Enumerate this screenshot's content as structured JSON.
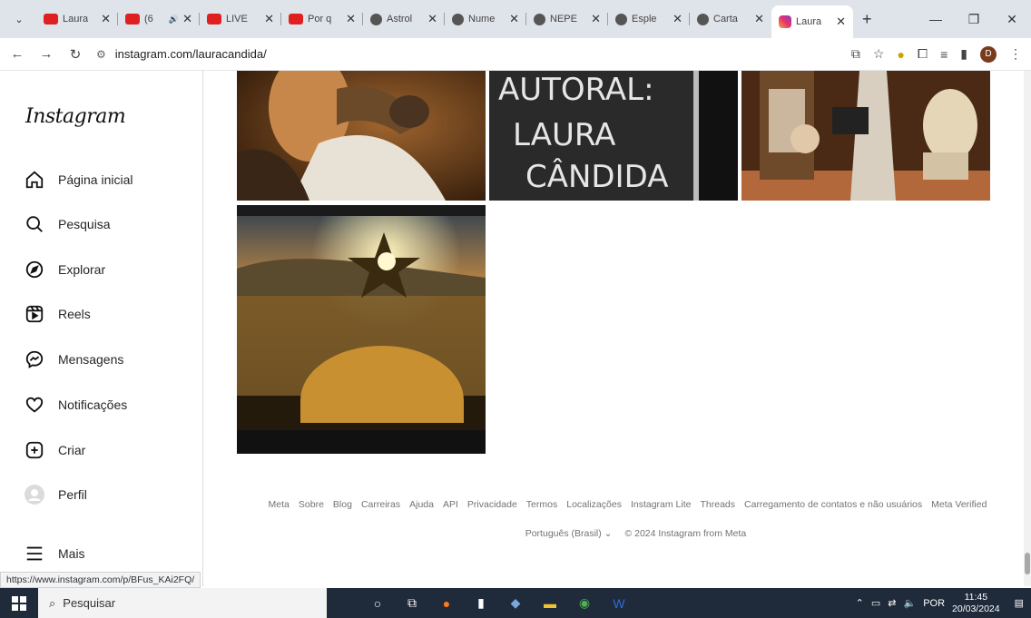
{
  "browser": {
    "tabs": [
      {
        "label": "Laura",
        "icon": "youtube-icon",
        "type": "yt"
      },
      {
        "label": "(6",
        "icon": "youtube-icon",
        "type": "yt",
        "audio": "🔊"
      },
      {
        "label": "LIVE",
        "icon": "youtube-icon",
        "type": "yt"
      },
      {
        "label": "Por q",
        "icon": "youtube-icon",
        "type": "yt"
      },
      {
        "label": "Astrol",
        "icon": "globe-icon",
        "type": "globe"
      },
      {
        "label": "Nume",
        "icon": "globe-icon",
        "type": "globe"
      },
      {
        "label": "NEPE",
        "icon": "search-icon",
        "type": "globe"
      },
      {
        "label": "Esple",
        "icon": "globe-icon",
        "type": "globe"
      },
      {
        "label": "Carta",
        "icon": "globe-icon",
        "type": "globe"
      },
      {
        "label": "Laura",
        "icon": "instagram-icon",
        "type": "ig",
        "active": true
      }
    ],
    "close_glyph": "✕",
    "new_tab": "+",
    "url": "instagram.com/lauracandida/",
    "profile_initial": "D"
  },
  "sidebar": {
    "logo": "Instagram",
    "items": [
      {
        "label": "Página inicial",
        "icon": "home-icon"
      },
      {
        "label": "Pesquisa",
        "icon": "search-icon"
      },
      {
        "label": "Explorar",
        "icon": "compass-icon"
      },
      {
        "label": "Reels",
        "icon": "reels-icon"
      },
      {
        "label": "Mensagens",
        "icon": "messenger-icon"
      },
      {
        "label": "Notificações",
        "icon": "heart-icon"
      },
      {
        "label": "Criar",
        "icon": "plus-square-icon"
      },
      {
        "label": "Perfil",
        "icon": "avatar-icon"
      }
    ],
    "more": "Mais"
  },
  "posts": {
    "post2_text": [
      "AUTORAL:",
      "LAURA",
      "CÂNDIDA"
    ]
  },
  "footer": {
    "links": [
      "Meta",
      "Sobre",
      "Blog",
      "Carreiras",
      "Ajuda",
      "API",
      "Privacidade",
      "Termos",
      "Localizações",
      "Instagram Lite",
      "Threads",
      "Carregamento de contatos e não usuários",
      "Meta Verified"
    ],
    "language": "Português (Brasil)",
    "copyright": "© 2024 Instagram from Meta"
  },
  "status_url": "https://www.instagram.com/p/BFus_KAi2FQ/",
  "taskbar": {
    "search_placeholder": "Pesquisar",
    "language": "POR",
    "time": "11:45",
    "date": "20/03/2024"
  }
}
